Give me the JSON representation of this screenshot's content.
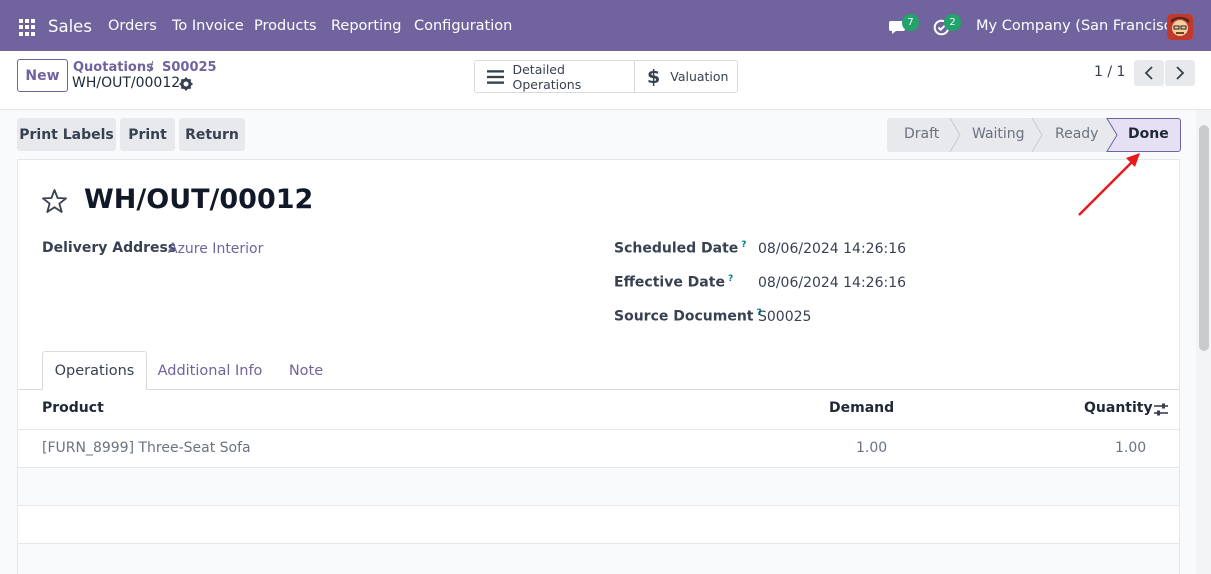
{
  "app": {
    "name": "Sales",
    "menu": [
      "Orders",
      "To Invoice",
      "Products",
      "Reporting",
      "Configuration"
    ],
    "chat_badge": "7",
    "activity_badge": "2",
    "company": "My Company (San Francisco)"
  },
  "control_panel": {
    "new_label": "New",
    "breadcrumb": [
      "Quotations",
      "S00025"
    ],
    "breadcrumb_sep": "/",
    "current": "WH/OUT/00012",
    "smart_buttons": [
      "Detailed Operations",
      "Valuation"
    ],
    "pager": "1 / 1"
  },
  "actions": [
    "Print Labels",
    "Print",
    "Return"
  ],
  "statusbar": {
    "stages": [
      "Draft",
      "Waiting",
      "Ready",
      "Done"
    ],
    "active": "Done"
  },
  "record": {
    "title": "WH/OUT/00012",
    "delivery_address_label": "Delivery Address",
    "delivery_address": "Azure Interior",
    "scheduled_date_label": "Scheduled Date",
    "scheduled_date": "08/06/2024 14:26:16",
    "effective_date_label": "Effective Date",
    "effective_date": "08/06/2024 14:26:16",
    "source_document_label": "Source Document",
    "source_document": "S00025",
    "help_mark": "?"
  },
  "tabs": [
    "Operations",
    "Additional Info",
    "Note"
  ],
  "table": {
    "headers": [
      "Product",
      "Demand",
      "Quantity"
    ],
    "rows": [
      {
        "product": "[FURN_8999] Three-Seat Sofa",
        "demand": "1.00",
        "quantity": "1.00"
      }
    ]
  },
  "colors": {
    "brand": "#71639e",
    "annotation_arrow": "#e8191b"
  }
}
